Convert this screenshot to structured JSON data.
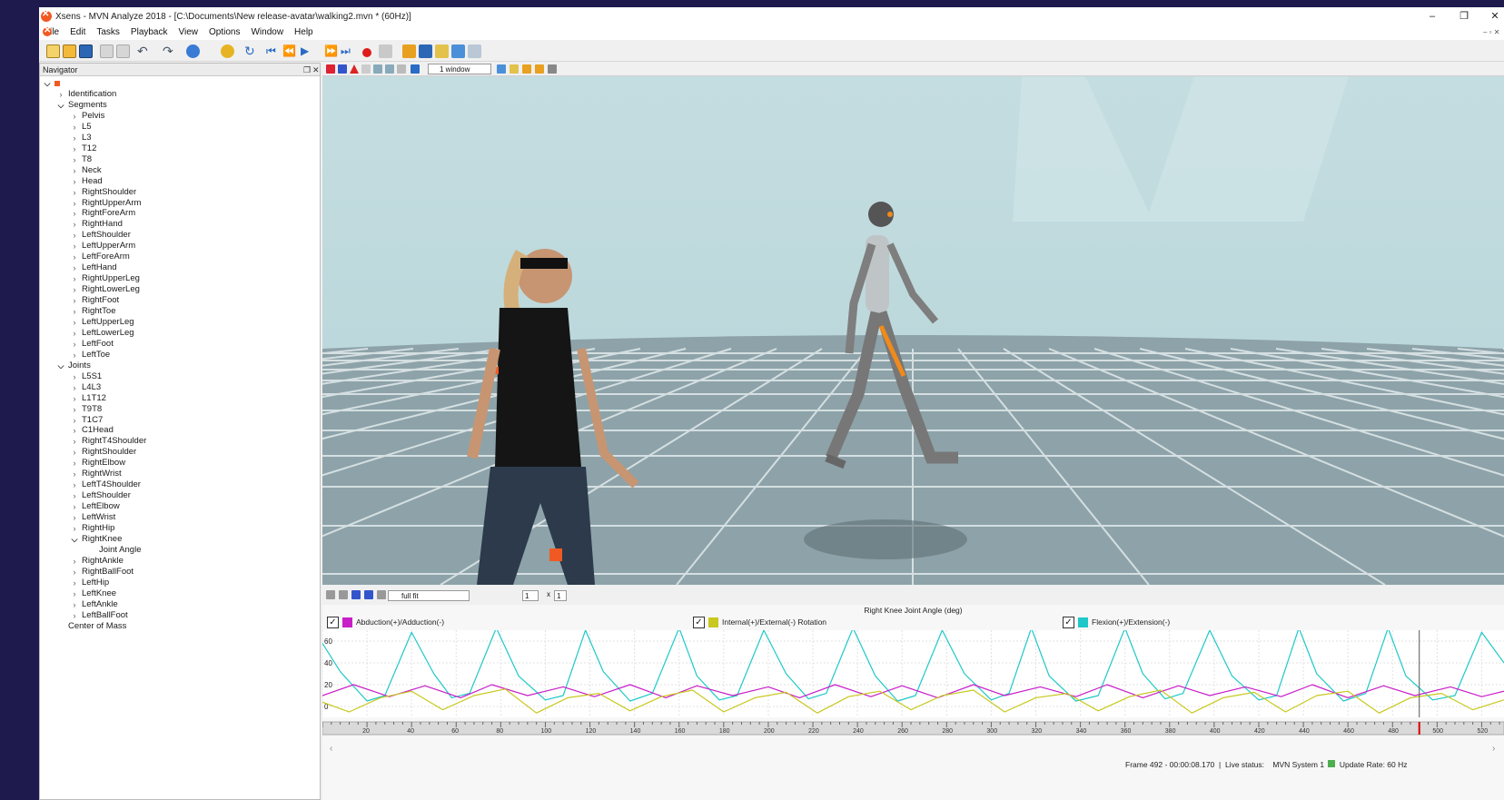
{
  "window": {
    "title": "Xsens - MVN Analyze 2018 - [C:\\Documents\\New release-avatar\\walking2.mvn * (60Hz)]",
    "controls": {
      "minimize": "–",
      "restore": "❐",
      "close": "✕"
    }
  },
  "menu": [
    "File",
    "Edit",
    "Tasks",
    "Playback",
    "View",
    "Options",
    "Window",
    "Help"
  ],
  "navigator": {
    "title": "Navigator",
    "tree": [
      {
        "label": "Identification",
        "level": 1,
        "state": "closed"
      },
      {
        "label": "Segments",
        "level": 1,
        "state": "open"
      },
      {
        "label": "Pelvis",
        "level": 2,
        "state": "closed"
      },
      {
        "label": "L5",
        "level": 2,
        "state": "closed"
      },
      {
        "label": "L3",
        "level": 2,
        "state": "closed"
      },
      {
        "label": "T12",
        "level": 2,
        "state": "closed"
      },
      {
        "label": "T8",
        "level": 2,
        "state": "closed"
      },
      {
        "label": "Neck",
        "level": 2,
        "state": "closed"
      },
      {
        "label": "Head",
        "level": 2,
        "state": "closed"
      },
      {
        "label": "RightShoulder",
        "level": 2,
        "state": "closed"
      },
      {
        "label": "RightUpperArm",
        "level": 2,
        "state": "closed"
      },
      {
        "label": "RightForeArm",
        "level": 2,
        "state": "closed"
      },
      {
        "label": "RightHand",
        "level": 2,
        "state": "closed"
      },
      {
        "label": "LeftShoulder",
        "level": 2,
        "state": "closed"
      },
      {
        "label": "LeftUpperArm",
        "level": 2,
        "state": "closed"
      },
      {
        "label": "LeftForeArm",
        "level": 2,
        "state": "closed"
      },
      {
        "label": "LeftHand",
        "level": 2,
        "state": "closed"
      },
      {
        "label": "RightUpperLeg",
        "level": 2,
        "state": "closed"
      },
      {
        "label": "RightLowerLeg",
        "level": 2,
        "state": "closed"
      },
      {
        "label": "RightFoot",
        "level": 2,
        "state": "closed"
      },
      {
        "label": "RightToe",
        "level": 2,
        "state": "closed"
      },
      {
        "label": "LeftUpperLeg",
        "level": 2,
        "state": "closed"
      },
      {
        "label": "LeftLowerLeg",
        "level": 2,
        "state": "closed"
      },
      {
        "label": "LeftFoot",
        "level": 2,
        "state": "closed"
      },
      {
        "label": "LeftToe",
        "level": 2,
        "state": "closed"
      },
      {
        "label": "Joints",
        "level": 1,
        "state": "open"
      },
      {
        "label": "L5S1",
        "level": 2,
        "state": "closed"
      },
      {
        "label": "L4L3",
        "level": 2,
        "state": "closed"
      },
      {
        "label": "L1T12",
        "level": 2,
        "state": "closed"
      },
      {
        "label": "T9T8",
        "level": 2,
        "state": "closed"
      },
      {
        "label": "T1C7",
        "level": 2,
        "state": "closed"
      },
      {
        "label": "C1Head",
        "level": 2,
        "state": "closed"
      },
      {
        "label": "RightT4Shoulder",
        "level": 2,
        "state": "closed"
      },
      {
        "label": "RightShoulder",
        "level": 2,
        "state": "closed"
      },
      {
        "label": "RightElbow",
        "level": 2,
        "state": "closed"
      },
      {
        "label": "RightWrist",
        "level": 2,
        "state": "closed"
      },
      {
        "label": "LeftT4Shoulder",
        "level": 2,
        "state": "closed"
      },
      {
        "label": "LeftShoulder",
        "level": 2,
        "state": "closed"
      },
      {
        "label": "LeftElbow",
        "level": 2,
        "state": "closed"
      },
      {
        "label": "LeftWrist",
        "level": 2,
        "state": "closed"
      },
      {
        "label": "RightHip",
        "level": 2,
        "state": "closed"
      },
      {
        "label": "RightKnee",
        "level": 2,
        "state": "open"
      },
      {
        "label": "Joint Angle",
        "level": 3,
        "state": "leaf"
      },
      {
        "label": "RightAnkle",
        "level": 2,
        "state": "closed"
      },
      {
        "label": "RightBallFoot",
        "level": 2,
        "state": "closed"
      },
      {
        "label": "LeftHip",
        "level": 2,
        "state": "closed"
      },
      {
        "label": "LeftKnee",
        "level": 2,
        "state": "closed"
      },
      {
        "label": "LeftAnkle",
        "level": 2,
        "state": "closed"
      },
      {
        "label": "LeftBallFoot",
        "level": 2,
        "state": "closed"
      },
      {
        "label": "Center of Mass",
        "level": 1,
        "state": "leaf"
      }
    ]
  },
  "viewport": {
    "layout_select": "1 window"
  },
  "graph": {
    "fit_select": "full fit",
    "page_value": "1",
    "page_sep": "x",
    "page_total": "1",
    "title": "Right Knee Joint Angle (deg)",
    "legend": [
      {
        "label": "Abduction(+)/Adduction(-)",
        "color": "#c81ec8",
        "checked": true
      },
      {
        "label": "Internal(+)/External(-) Rotation",
        "color": "#c8c81e",
        "checked": true
      },
      {
        "label": "Flexion(+)/Extension(-)",
        "color": "#1ec8c8",
        "checked": true
      }
    ],
    "check_mark": "✓",
    "y_ticks": [
      "60",
      "40",
      "20",
      "0"
    ],
    "x_ticks": [
      "20",
      "40",
      "60",
      "80",
      "100",
      "120",
      "140",
      "160",
      "180",
      "200",
      "220",
      "240",
      "260",
      "280",
      "300",
      "320",
      "340",
      "360",
      "380",
      "400",
      "420",
      "440",
      "460",
      "480",
      "500",
      "520"
    ],
    "current_frame": 492
  },
  "chart_data": {
    "type": "line",
    "title": "Right Knee Joint Angle (deg)",
    "xlim": [
      0,
      530
    ],
    "ylim": [
      -10,
      70
    ],
    "series": [
      {
        "name": "Flexion(+)/Extension(-)",
        "color": "#1ec8c8",
        "x": [
          0,
          8,
          20,
          28,
          40,
          50,
          58,
          66,
          78,
          88,
          100,
          108,
          118,
          126,
          138,
          148,
          160,
          168,
          178,
          186,
          198,
          208,
          218,
          226,
          238,
          248,
          258,
          266,
          278,
          288,
          300,
          308,
          318,
          326,
          338,
          348,
          360,
          368,
          378,
          386,
          398,
          408,
          420,
          428,
          438,
          446,
          458,
          468,
          478,
          486,
          498,
          508,
          520,
          530
        ],
        "y": [
          58,
          32,
          5,
          10,
          68,
          30,
          8,
          12,
          72,
          28,
          6,
          10,
          70,
          32,
          5,
          12,
          72,
          28,
          6,
          10,
          70,
          30,
          7,
          12,
          72,
          28,
          5,
          10,
          70,
          30,
          6,
          12,
          72,
          28,
          5,
          10,
          72,
          30,
          7,
          12,
          70,
          28,
          6,
          10,
          72,
          30,
          5,
          12,
          72,
          28,
          6,
          10,
          68,
          40
        ]
      },
      {
        "name": "Abduction(+)/Adduction(-)",
        "color": "#c81ec8",
        "x": [
          0,
          14,
          30,
          46,
          62,
          76,
          92,
          108,
          122,
          138,
          154,
          168,
          184,
          200,
          214,
          230,
          246,
          260,
          276,
          292,
          306,
          322,
          338,
          352,
          368,
          384,
          398,
          414,
          430,
          444,
          460,
          476,
          490,
          506,
          520,
          530
        ],
        "y": [
          10,
          20,
          9,
          19,
          8,
          20,
          10,
          18,
          9,
          20,
          8,
          19,
          10,
          18,
          8,
          20,
          9,
          19,
          8,
          20,
          10,
          18,
          9,
          20,
          8,
          19,
          10,
          18,
          9,
          20,
          8,
          19,
          10,
          18,
          9,
          14
        ]
      },
      {
        "name": "Internal(+)/External(-) Rotation",
        "color": "#c8c81e",
        "x": [
          0,
          12,
          26,
          40,
          54,
          68,
          82,
          96,
          110,
          124,
          138,
          152,
          166,
          180,
          194,
          208,
          222,
          236,
          250,
          264,
          278,
          292,
          306,
          320,
          334,
          348,
          362,
          376,
          390,
          404,
          418,
          432,
          446,
          460,
          474,
          488,
          502,
          516,
          530
        ],
        "y": [
          4,
          -5,
          8,
          14,
          -3,
          10,
          16,
          -6,
          8,
          12,
          -4,
          9,
          15,
          -5,
          8,
          13,
          -6,
          9,
          14,
          -3,
          10,
          15,
          -5,
          8,
          12,
          -4,
          9,
          15,
          -6,
          8,
          13,
          -5,
          10,
          14,
          -6,
          8,
          12,
          -3,
          6
        ]
      }
    ]
  },
  "status": {
    "frame": "Frame 492 - 00:00:08.170",
    "live_status": "Live status:",
    "system": "MVN System 1",
    "update_rate": "Update Rate: 60 Hz"
  }
}
